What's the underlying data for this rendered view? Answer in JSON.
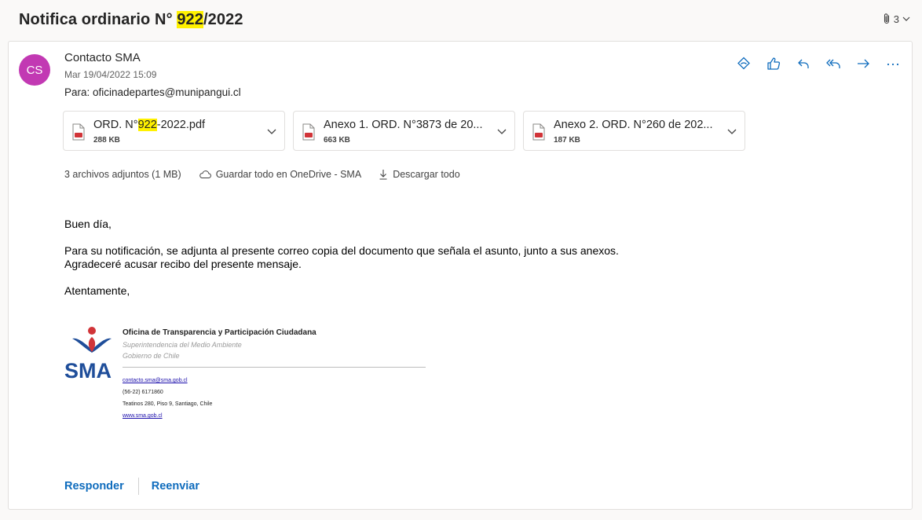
{
  "subject": {
    "prefix": "Notifica ordinario N° ",
    "highlight": "922",
    "suffix": "/2022"
  },
  "thread": {
    "count": "3",
    "attachment_icon": "paperclip-icon",
    "chevron_icon": "chevron-down-icon"
  },
  "message": {
    "avatar_initials": "CS",
    "avatar_color": "#c239b3",
    "sender": "Contacto SMA",
    "date": "Mar 19/04/2022 15:09",
    "to": "Para: oficinadepartes@munipangui.cl"
  },
  "actions": [
    {
      "name": "immersive-reader-icon"
    },
    {
      "name": "like-icon"
    },
    {
      "name": "reply-icon"
    },
    {
      "name": "reply-all-icon"
    },
    {
      "name": "forward-icon"
    },
    {
      "name": "more-actions-icon"
    }
  ],
  "attachments": [
    {
      "name_prefix": "ORD. N°",
      "name_highlight": "922",
      "name_suffix": "-2022.pdf",
      "size": "288 KB"
    },
    {
      "name_prefix": "Anexo 1. ORD. N°3873 de 20...",
      "name_highlight": "",
      "name_suffix": "",
      "size": "663 KB"
    },
    {
      "name_prefix": "Anexo 2. ORD. N°260 de 202...",
      "name_highlight": "",
      "name_suffix": "",
      "size": "187 KB"
    }
  ],
  "attachment_info": {
    "summary": "3 archivos adjuntos (1 MB)",
    "save_onedrive": "Guardar todo en OneDrive - SMA",
    "download_all": "Descargar todo"
  },
  "body": {
    "greeting": "Buen día,",
    "line1": "Para su notificación, se adjunta al presente correo copia del documento que señala el asunto, junto a sus anexos.",
    "line2": "Agradeceré acusar recibo del presente mensaje.",
    "closing": "Atentamente,"
  },
  "signature": {
    "logo_text": "SMA",
    "title": "Oficina de Transparencia y Participación Ciudadana",
    "subtitle1": "Superintendencia del Medio Ambiente",
    "subtitle2": "Gobierno de Chile",
    "email": "contacto.sma@sma.gob.cl",
    "phone": "(56-22) 6171860",
    "address": "Teatinos 280, Piso 9, Santiago, Chile",
    "website": "www.sma.gob.cl"
  },
  "footer": {
    "reply": "Responder",
    "forward": "Reenviar"
  },
  "colors": {
    "accent": "#0f6cbd",
    "highlight": "#fff100",
    "pdf_red": "#d13438"
  }
}
